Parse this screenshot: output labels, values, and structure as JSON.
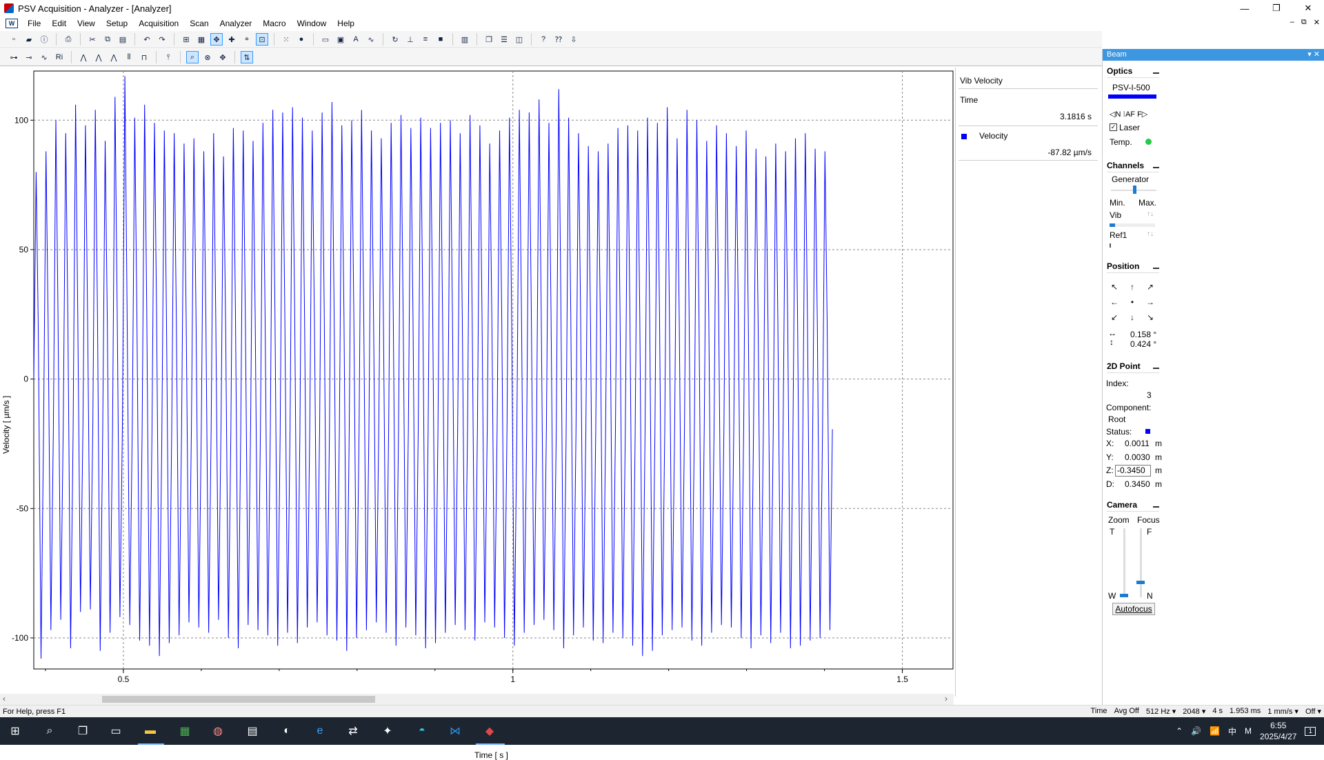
{
  "window": {
    "title": "PSV Acquisition - Analyzer - [Analyzer]",
    "controls": [
      "—",
      "❐",
      "✕"
    ]
  },
  "menu": {
    "items": [
      "File",
      "Edit",
      "View",
      "Setup",
      "Acquisition",
      "Scan",
      "Analyzer",
      "Macro",
      "Window",
      "Help"
    ],
    "logo": "W",
    "mdi_controls": [
      "–",
      "⧉",
      "✕"
    ]
  },
  "chart": {
    "ylabel": "Velocity [ µm/s ]",
    "xlabel": "Time [ s ]",
    "y_ticks": [
      "100",
      "50",
      "0",
      "-50",
      "-100"
    ],
    "x_ticks": [
      "0.5",
      "1",
      "1.5"
    ],
    "line_color": "#0000ff"
  },
  "chart_data": {
    "type": "line",
    "xlabel": "Time [ s ]",
    "ylabel": "Velocity [ µm/s ]",
    "xlim": [
      0.385,
      1.565
    ],
    "ylim": [
      -112,
      119
    ],
    "x_ticks": [
      0.5,
      1,
      1.5
    ],
    "y_ticks": [
      -100,
      -50,
      0,
      50,
      100
    ],
    "grid": true,
    "series": [
      {
        "name": "Velocity",
        "color": "#0000ff",
        "signal_frequency_hz": 79,
        "peaks": [
          80,
          88,
          100,
          95,
          106,
          98,
          104,
          92,
          109,
          117,
          101,
          106,
          99,
          96,
          95,
          91,
          93,
          88,
          95,
          86,
          97,
          96,
          92,
          99,
          104,
          103,
          105,
          101,
          96,
          103,
          107,
          98,
          100,
          104,
          96,
          93,
          99,
          102,
          97,
          101,
          97,
          99,
          100,
          95,
          102,
          98,
          91,
          96,
          101,
          104,
          103,
          108,
          99,
          112,
          101,
          95,
          90,
          88,
          91,
          97,
          98,
          96,
          101,
          99,
          105,
          93,
          104,
          100,
          92,
          98,
          95,
          90,
          96,
          89,
          86,
          91,
          88,
          93,
          95,
          89,
          88
        ],
        "troughs": [
          -108,
          -97,
          -93,
          -104,
          -90,
          -89,
          -105,
          -98,
          -92,
          -95,
          -101,
          -103,
          -107,
          -102,
          -99,
          -94,
          -96,
          -98,
          -93,
          -100,
          -104,
          -95,
          -97,
          -99,
          -103,
          -98,
          -102,
          -96,
          -94,
          -99,
          -101,
          -105,
          -100,
          -97,
          -94,
          -98,
          -103,
          -96,
          -99,
          -104,
          -102,
          -98,
          -95,
          -97,
          -101,
          -94,
          -96,
          -100,
          -103,
          -98,
          -95,
          -93,
          -97,
          -104,
          -99,
          -96,
          -101,
          -102,
          -98,
          -100,
          -103,
          -107,
          -105,
          -99,
          -97,
          -96,
          -101,
          -103,
          -98,
          -95,
          -96,
          -100,
          -104,
          -99,
          -102,
          -98,
          -104,
          -103,
          -101,
          -100,
          -97
        ]
      }
    ],
    "cursor": {
      "time_s": 3.1816,
      "velocity_um_s": -87.82
    }
  },
  "readout": {
    "title": "Vib Velocity",
    "time_label": "Time",
    "time_value": "3.1816 s",
    "velocity_label": "Velocity",
    "velocity_value": "-87.82 µm/s",
    "velocity_color": "#0000ff"
  },
  "beam": {
    "header": "Beam",
    "header_controls": "▾ ✕",
    "optics": {
      "title": "Optics",
      "model": "PSV-I-500",
      "nav": "◁N  ⁝AF  F▷",
      "laser_label": "Laser",
      "laser_checked": true,
      "temp_label": "Temp.",
      "temp_status_color": "#22cc44"
    },
    "channels": {
      "title": "Channels",
      "generator_label": "Generator",
      "min_label": "Min.",
      "max_label": "Max.",
      "vib_label": "Vib",
      "ref1_label": "Ref1",
      "updown": "↑↓"
    },
    "position": {
      "title": "Position",
      "arrows": [
        "↖",
        "↑",
        "↗",
        "←",
        "•",
        "→",
        "↙",
        "↓",
        "↘"
      ],
      "h_icon": "↔",
      "h_value": "0.158 °",
      "v_icon": "↕",
      "v_value": "0.424 °"
    },
    "point2d": {
      "title": "2D Point",
      "index_label": "Index:",
      "index_value": "3",
      "component_label": "Component:",
      "component_value": "Root",
      "status_label": "Status:",
      "status_color": "#0000ff",
      "x_label": "X:",
      "x_value": "0.0011",
      "y_label": "Y:",
      "y_value": "0.0030",
      "z_label": "Z:",
      "z_value": "-0.3450",
      "d_label": "D:",
      "d_value": "0.3450",
      "unit": "m"
    },
    "camera": {
      "title": "Camera",
      "zoom_label": "Zoom",
      "focus_label": "Focus",
      "t_label": "T",
      "f_label": "F",
      "w_label": "W",
      "n_label": "N",
      "autofocus_label": "Autofocus"
    }
  },
  "statusbar": {
    "help": "For Help, press F1",
    "cells": [
      "Time",
      "Avg Off",
      "512 Hz ▾",
      "2048 ▾",
      "4 s",
      "1.953 ms",
      "1 mm/s ▾",
      "Off ▾"
    ]
  },
  "taskbar": {
    "tray_icons": [
      "⌃",
      "🔊",
      "📶",
      "中",
      "M"
    ],
    "time": "6:55",
    "date": "2025/4/27",
    "notification": "1"
  }
}
